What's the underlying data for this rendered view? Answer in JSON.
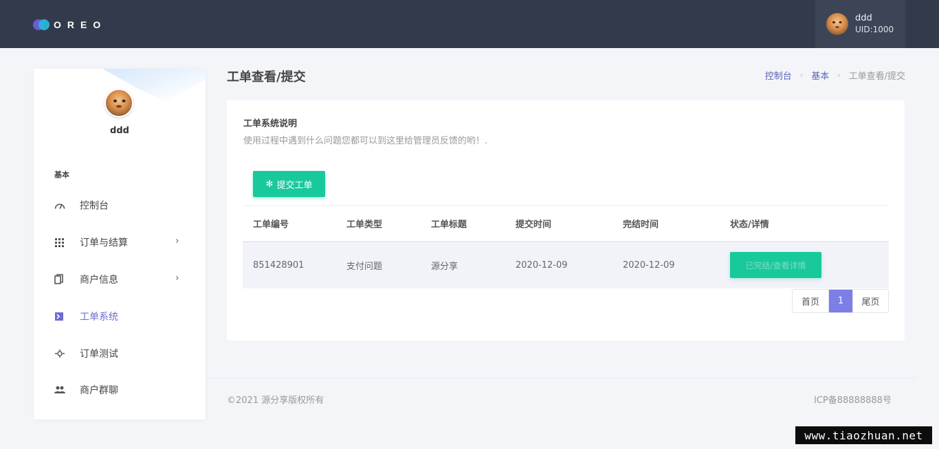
{
  "header": {
    "logo_text": "OREO",
    "user": {
      "name": "ddd",
      "uid": "UID:1000"
    }
  },
  "sidebar": {
    "profile_name": "ddd",
    "section_label": "基本",
    "items": [
      {
        "label": "控制台",
        "icon": "dashboard-icon"
      },
      {
        "label": "订单与结算",
        "icon": "grid-icon",
        "has_submenu": true
      },
      {
        "label": "商户信息",
        "icon": "copy-icon",
        "has_submenu": true
      },
      {
        "label": "工单系统",
        "icon": "terminal-icon",
        "active": true
      },
      {
        "label": "订单测试",
        "icon": "dial-icon"
      },
      {
        "label": "商户群聊",
        "icon": "users-icon"
      }
    ]
  },
  "page": {
    "title": "工单查看/提交",
    "breadcrumb": [
      "控制台",
      "基本",
      "工单查看/提交"
    ]
  },
  "card": {
    "title": "工单系统说明",
    "description": "使用过程中遇到什么问题您都可以到这里给管理员反馈的哟！.",
    "submit_label": "提交工单",
    "table": {
      "headers": [
        "工单编号",
        "工单类型",
        "工单标题",
        "提交时间",
        "完结时间",
        "状态/详情"
      ],
      "rows": [
        {
          "id": "851428901",
          "type": "支付问题",
          "title": "源分享",
          "submitted": "2020-12-09",
          "completed": "2020-12-09",
          "status_label": "已完结/查看详情"
        }
      ]
    },
    "pagination": {
      "first": "首页",
      "current": "1",
      "last": "尾页"
    }
  },
  "footer": {
    "copyright": "©2021 源分享版权所有",
    "icp": "ICP备88888888号"
  },
  "watermark": "www.tiaozhuan.net",
  "colors": {
    "topbar": "#323b4b",
    "accent_green": "#18c99b",
    "accent_purple": "#7b7fe6",
    "active_nav": "#6b6fd0"
  }
}
